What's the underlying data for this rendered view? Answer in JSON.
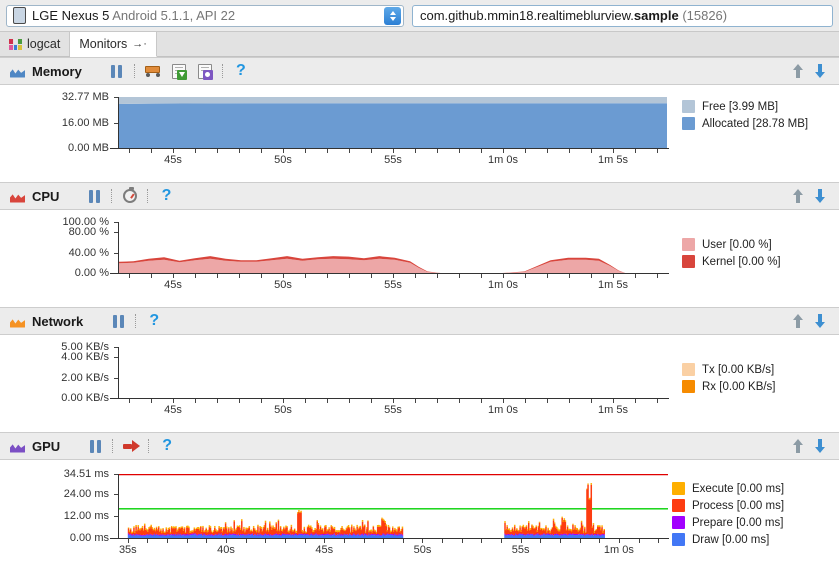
{
  "topbar": {
    "device_icon": "phone-icon",
    "device_name": "LGE Nexus 5",
    "device_os": "Android 5.1.1, API 22",
    "process_name": "com.github.mmin18.realtimeblurview.",
    "process_name_bold": "sample",
    "process_pid": "(15826)"
  },
  "tabs": [
    {
      "label": "logcat",
      "icon": "logcat-icon",
      "active": false
    },
    {
      "label": "Monitors",
      "icon": "arrow-right-icon",
      "active": true,
      "arrow": "→·"
    }
  ],
  "panels": {
    "memory": {
      "title": "Memory",
      "icon_color": "#4f87c4",
      "toolbar": {
        "pause": "Pause",
        "gc": "Initiate GC",
        "heap_dump": "Dump Java Heap",
        "alloc_tracker": "Start Allocation Tracking",
        "help": "?"
      },
      "nav": {
        "up": "Previous",
        "down": "Next"
      },
      "y_labels": [
        "32.77 MB",
        "16.00 MB",
        "0.00 MB"
      ],
      "y_positions": [
        100,
        49,
        0
      ],
      "x_labels": [
        "45s",
        "50s",
        "55s",
        "1m 0s",
        "1m 5s"
      ],
      "legend": [
        {
          "label": "Free [3.99 MB]",
          "color": "#b3c5d7"
        },
        {
          "label": "Allocated [28.78 MB]",
          "color": "#6b9bd2"
        }
      ]
    },
    "cpu": {
      "title": "CPU",
      "icon_color": "#d8453c",
      "toolbar": {
        "pause": "Pause",
        "method_trace": "Start Method Tracing",
        "help": "?"
      },
      "nav": {
        "up": "Previous",
        "down": "Next"
      },
      "y_labels": [
        "100.00 %",
        "80.00 %",
        "40.00 %",
        "0.00 %"
      ],
      "y_positions": [
        100,
        80,
        40,
        0
      ],
      "x_labels": [
        "45s",
        "50s",
        "55s",
        "1m 0s",
        "1m 5s"
      ],
      "legend": [
        {
          "label": "User [0.00 %]",
          "color": "#eda7a7"
        },
        {
          "label": "Kernel [0.00 %]",
          "color": "#d8453c"
        }
      ]
    },
    "network": {
      "title": "Network",
      "icon_color": "#f59223",
      "toolbar": {
        "pause": "Pause",
        "help": "?"
      },
      "nav": {
        "up": "Previous",
        "down": "Next"
      },
      "y_labels": [
        "5.00 KB/s",
        "4.00 KB/s",
        "2.00 KB/s",
        "0.00 KB/s"
      ],
      "y_positions": [
        100,
        80,
        40,
        0
      ],
      "x_labels": [
        "45s",
        "50s",
        "55s",
        "1m 0s",
        "1m 5s"
      ],
      "legend": [
        {
          "label": "Tx [0.00 KB/s]",
          "color": "#fad0a4"
        },
        {
          "label": "Rx [0.00 KB/s]",
          "color": "#f68b00"
        }
      ]
    },
    "gpu": {
      "title": "GPU",
      "icon_color": "#7b4fc4",
      "toolbar": {
        "pause": "Pause",
        "trace": "Start GPU Trace",
        "help": "?"
      },
      "nav": {
        "up": "Previous",
        "down": "Next"
      },
      "y_labels": [
        "34.51 ms",
        "24.00 ms",
        "12.00 ms",
        "0.00 ms"
      ],
      "y_positions": [
        100,
        69.5,
        34.8,
        0
      ],
      "x_labels": [
        "35s",
        "40s",
        "45s",
        "50s",
        "55s",
        "1m 0s"
      ],
      "threshold_line_green": 16.0,
      "threshold_line_red": 34.51,
      "legend": [
        {
          "label": "Execute [0.00 ms]",
          "color": "#feaf00"
        },
        {
          "label": "Process [0.00 ms]",
          "color": "#fd3c11"
        },
        {
          "label": "Prepare [0.00 ms]",
          "color": "#a200ff"
        },
        {
          "label": "Draw [0.00 ms]",
          "color": "#4277f5"
        }
      ]
    }
  },
  "chart_data": [
    {
      "id": "memory",
      "type": "area",
      "title": "Memory",
      "ylabel": "MB",
      "ylim": [
        0,
        32.77
      ],
      "xlim": [
        42.5,
        67.5
      ],
      "xticks": [
        45,
        50,
        55,
        60,
        65
      ],
      "xticklabels": [
        "45s",
        "50s",
        "55s",
        "1m 0s",
        "1m 5s"
      ],
      "yticks": [
        0,
        16,
        32.77
      ],
      "yticklabels": [
        "0.00 MB",
        "16.00 MB",
        "32.77 MB"
      ],
      "stacked": true,
      "x": [
        42.5,
        44,
        45.5,
        47,
        48.5,
        50,
        51.5,
        53,
        54.5,
        56,
        57.5,
        59,
        60.5,
        62,
        63.5,
        65,
        66.5,
        67.5
      ],
      "series": [
        {
          "name": "Allocated",
          "color": "#6b9bd2",
          "values": [
            28.3,
            28.5,
            28.6,
            28.7,
            28.78,
            28.78,
            28.78,
            28.78,
            28.78,
            28.78,
            28.78,
            28.78,
            28.78,
            28.78,
            28.78,
            28.78,
            28.78,
            28.78
          ]
        },
        {
          "name": "Free",
          "color": "#b3c5d7",
          "values": [
            4.47,
            4.27,
            4.17,
            4.07,
            3.99,
            3.99,
            3.99,
            3.99,
            3.99,
            3.99,
            3.99,
            3.99,
            3.99,
            3.99,
            3.99,
            3.99,
            3.99,
            3.99
          ]
        }
      ]
    },
    {
      "id": "cpu",
      "type": "area",
      "title": "CPU",
      "ylabel": "%",
      "ylim": [
        0,
        100
      ],
      "xlim": [
        42.5,
        67.5
      ],
      "xticks": [
        45,
        50,
        55,
        60,
        65
      ],
      "xticklabels": [
        "45s",
        "50s",
        "55s",
        "1m 0s",
        "1m 5s"
      ],
      "yticks": [
        0,
        40,
        80,
        100
      ],
      "yticklabels": [
        "0.00 %",
        "40.00 %",
        "80.00 %",
        "100.00 %"
      ],
      "stacked": true,
      "x": [
        42.5,
        43.2,
        43.9,
        44.6,
        45.3,
        46.0,
        46.7,
        47.4,
        48.1,
        48.8,
        49.5,
        50.2,
        50.9,
        51.6,
        52.3,
        53.0,
        53.7,
        54.4,
        55.1,
        55.8,
        56.2,
        56.6,
        57.2,
        58.5,
        60.0,
        61.0,
        61.6,
        62.2,
        63.0,
        63.8,
        64.4,
        64.9,
        65.3,
        65.6,
        67.5
      ],
      "series": [
        {
          "name": "User",
          "color": "#eda7a7",
          "values": [
            19,
            20,
            24,
            26,
            21,
            25,
            28,
            24,
            22,
            22,
            25,
            28,
            24,
            27,
            28,
            27,
            25,
            28,
            26,
            20,
            10,
            2,
            0,
            0,
            0,
            2,
            12,
            22,
            26,
            26,
            24,
            14,
            4,
            0,
            0
          ]
        },
        {
          "name": "Kernel",
          "color": "#d8453c",
          "values": [
            3,
            3,
            4,
            5,
            3,
            4,
            5,
            4,
            3,
            3,
            4,
            5,
            4,
            4,
            5,
            5,
            4,
            5,
            4,
            3,
            2,
            1,
            0,
            0,
            0,
            1,
            2,
            3,
            4,
            4,
            4,
            2,
            1,
            0,
            0
          ]
        }
      ]
    },
    {
      "id": "network",
      "type": "area",
      "title": "Network",
      "ylabel": "KB/s",
      "ylim": [
        0,
        5
      ],
      "xlim": [
        42.5,
        67.5
      ],
      "xticks": [
        45,
        50,
        55,
        60,
        65
      ],
      "xticklabels": [
        "45s",
        "50s",
        "55s",
        "1m 0s",
        "1m 5s"
      ],
      "yticks": [
        0,
        2,
        4,
        5
      ],
      "yticklabels": [
        "0.00 KB/s",
        "2.00 KB/s",
        "4.00 KB/s",
        "5.00 KB/s"
      ],
      "stacked": true,
      "x": [
        42.5,
        67.5
      ],
      "series": [
        {
          "name": "Tx",
          "color": "#fad0a4",
          "values": [
            0,
            0
          ]
        },
        {
          "name": "Rx",
          "color": "#f68b00",
          "values": [
            0,
            0
          ]
        }
      ]
    },
    {
      "id": "gpu",
      "type": "area",
      "title": "GPU",
      "ylabel": "ms",
      "ylim": [
        0,
        34.51
      ],
      "xlim": [
        34.5,
        62.5
      ],
      "xticks": [
        35,
        40,
        45,
        50,
        55,
        60
      ],
      "xticklabels": [
        "35s",
        "40s",
        "45s",
        "50s",
        "55s",
        "1m 0s"
      ],
      "yticks": [
        0,
        12,
        24,
        34.51
      ],
      "yticklabels": [
        "0.00 ms",
        "12.00 ms",
        "24.00 ms",
        "34.51 ms"
      ],
      "stacked": true,
      "threshold_green": 16.0,
      "threshold_red": 34.51,
      "note": "Dense per-frame bars; gap between ~49s and ~54s. Spike near 58.5s reaches ~31 ms.",
      "frames_active_ranges": [
        [
          35.0,
          49.0
        ],
        [
          54.2,
          59.3
        ]
      ]
    }
  ]
}
